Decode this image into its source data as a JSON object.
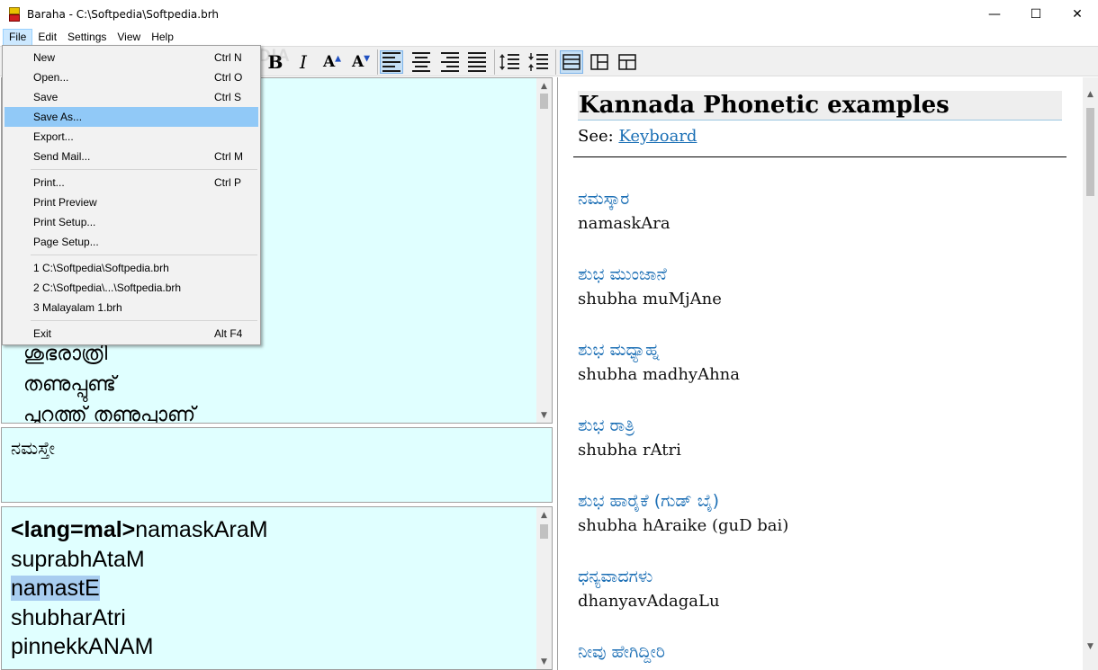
{
  "window": {
    "title": "Baraha - C:\\Softpedia\\Softpedia.brh",
    "minimize": "—",
    "maximize": "☐",
    "close": "✕"
  },
  "menubar": {
    "items": [
      "File",
      "Edit",
      "Settings",
      "View",
      "Help"
    ]
  },
  "toolbar": {
    "bold": "B",
    "italic": "I",
    "font_up": "A",
    "font_down": "A",
    "watermark": "SOFTPEDIA"
  },
  "file_menu": {
    "items": [
      {
        "label": "New",
        "shortcut": "Ctrl N"
      },
      {
        "label": "Open...",
        "shortcut": "Ctrl O"
      },
      {
        "label": "Save",
        "shortcut": "Ctrl S"
      },
      {
        "label": "Save As...",
        "shortcut": ""
      },
      {
        "label": "Export...",
        "shortcut": ""
      },
      {
        "label": "Send Mail...",
        "shortcut": "Ctrl M"
      },
      {
        "label": "Print...",
        "shortcut": "Ctrl P"
      },
      {
        "label": "Print Preview",
        "shortcut": ""
      },
      {
        "label": "Print Setup...",
        "shortcut": ""
      },
      {
        "label": "Page Setup...",
        "shortcut": ""
      },
      {
        "label": "1 C:\\Softpedia\\Softpedia.brh",
        "shortcut": ""
      },
      {
        "label": "2 C:\\Softpedia\\...\\Softpedia.brh",
        "shortcut": ""
      },
      {
        "label": "3 Malayalam 1.brh",
        "shortcut": ""
      },
      {
        "label": "Exit",
        "shortcut": "Alt F4"
      }
    ],
    "selected": "Save As..."
  },
  "editor_output": {
    "lines": [
      "ശുഭരാത്രി",
      "തണുപ്പുണ്ട്",
      "പുറത്ത് തണുപ്പാണ്"
    ]
  },
  "preview_word": "ನಮಸ್ತೇ",
  "source_editor": {
    "tag": "<lang=mal>",
    "lines": [
      "namaskAraM",
      "suprabhAtaM",
      "namastE",
      "shubharAtri",
      "pinnekkANAM"
    ]
  },
  "help_pane": {
    "title": "Kannada Phonetic examples",
    "see_label": "See:",
    "see_link": "Keyboard",
    "examples": [
      {
        "kannada": "ನಮಸ್ಕಾರ",
        "phonetic": "namaskAra"
      },
      {
        "kannada": "ಶುಭ ಮುಂಜಾನೆ",
        "phonetic": "shubha muMjAne"
      },
      {
        "kannada": "ಶುಭ ಮಧ್ಯಾಹ್ನ",
        "phonetic": "shubha madhyAhna"
      },
      {
        "kannada": "ಶುಭ ರಾತ್ರಿ",
        "phonetic": "shubha rAtri"
      },
      {
        "kannada": "ಶುಭ ಹಾರೈಕೆ (ಗುಡ್ ಬೈ)",
        "phonetic": "shubha hAraike (guD bai)"
      },
      {
        "kannada": "ಧನ್ಯವಾದಗಳು",
        "phonetic": "dhanyavAdagaLu"
      },
      {
        "kannada": "ನೀವು ಹೇಗಿದ್ದೀರಿ",
        "phonetic": ""
      }
    ]
  },
  "colors": {
    "editor_bg": "#e0ffff",
    "menu_highlight": "#91c9f7",
    "link": "#1a6fb5",
    "kannada_text": "#1c6fb5"
  }
}
